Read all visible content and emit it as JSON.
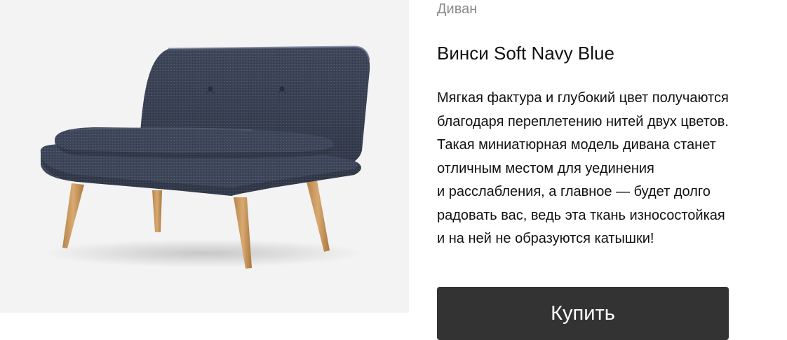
{
  "product": {
    "category": "Диван",
    "title": "Винси Soft Navy Blue",
    "description_lines": [
      "Мягкая фактура и глубокий цвет получаются",
      "благодаря переплетению нитей двух цветов.",
      "Такая миниатюрная модель дивана станет",
      "отличным местом для уединения",
      "и расслабления, а главное — будет долго",
      "радовать вас, ведь эта ткань износостойкая",
      "и на ней не образуются катышки!"
    ],
    "buy_label": "Купить"
  },
  "colors": {
    "image_background": "#f3f3f3",
    "upholstery": "#3e4659",
    "legs": "#c89a62",
    "button": "#333333",
    "button_text": "#ffffff",
    "category_text": "#8a8a8a"
  }
}
